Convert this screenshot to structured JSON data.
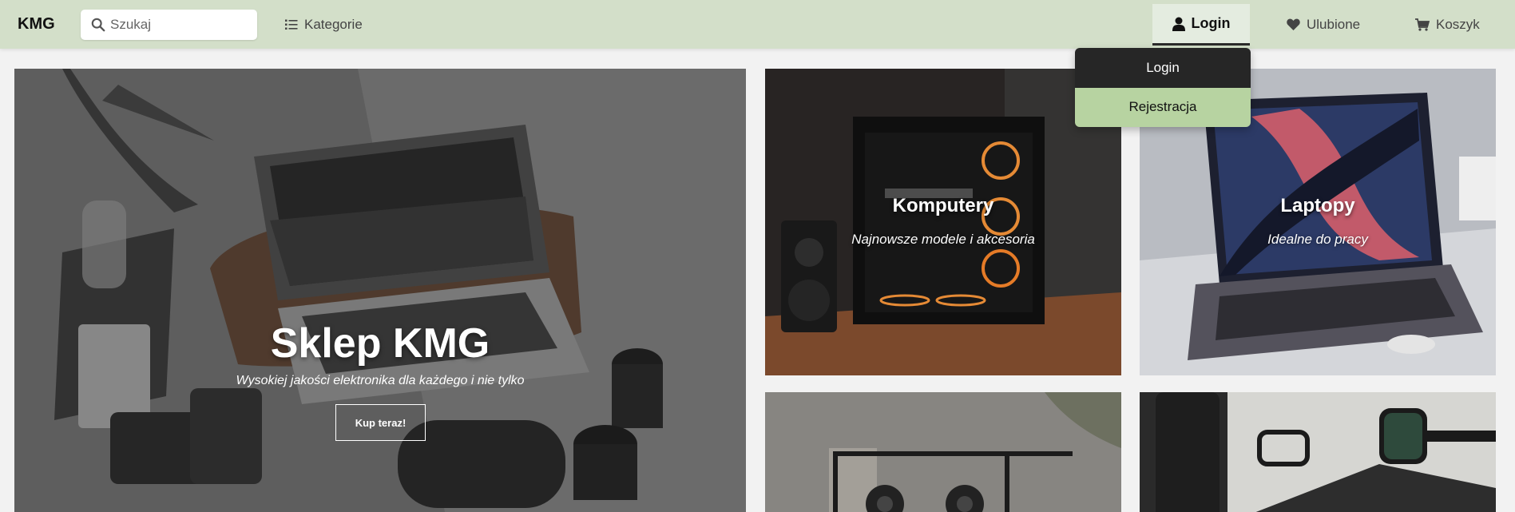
{
  "navbar": {
    "logo": "KMG",
    "search_placeholder": "Szukaj",
    "categories_label": "Kategorie",
    "login_label": "Login",
    "favorites_label": "Ulubione",
    "cart_label": "Koszyk"
  },
  "dropdown": {
    "items": [
      "Login",
      "Rejestracja"
    ]
  },
  "hero": {
    "title": "Sklep KMG",
    "subtitle": "Wysokiej jakości elektronika dla każdego i nie tylko",
    "button": "Kup teraz!"
  },
  "tiles": [
    {
      "title": "Komputery",
      "subtitle": "Najnowsze modele i akcesoria"
    },
    {
      "title": "Laptopy",
      "subtitle": "Idealne do pracy"
    }
  ],
  "colors": {
    "navbar_bg": "#d3dfc9",
    "dropdown_dark": "#262626",
    "dropdown_accent": "#b7d3a1"
  },
  "icons": {
    "search": "search-icon",
    "categories": "list-icon",
    "login": "user-icon",
    "favorites": "heart-icon",
    "cart": "cart-icon"
  }
}
